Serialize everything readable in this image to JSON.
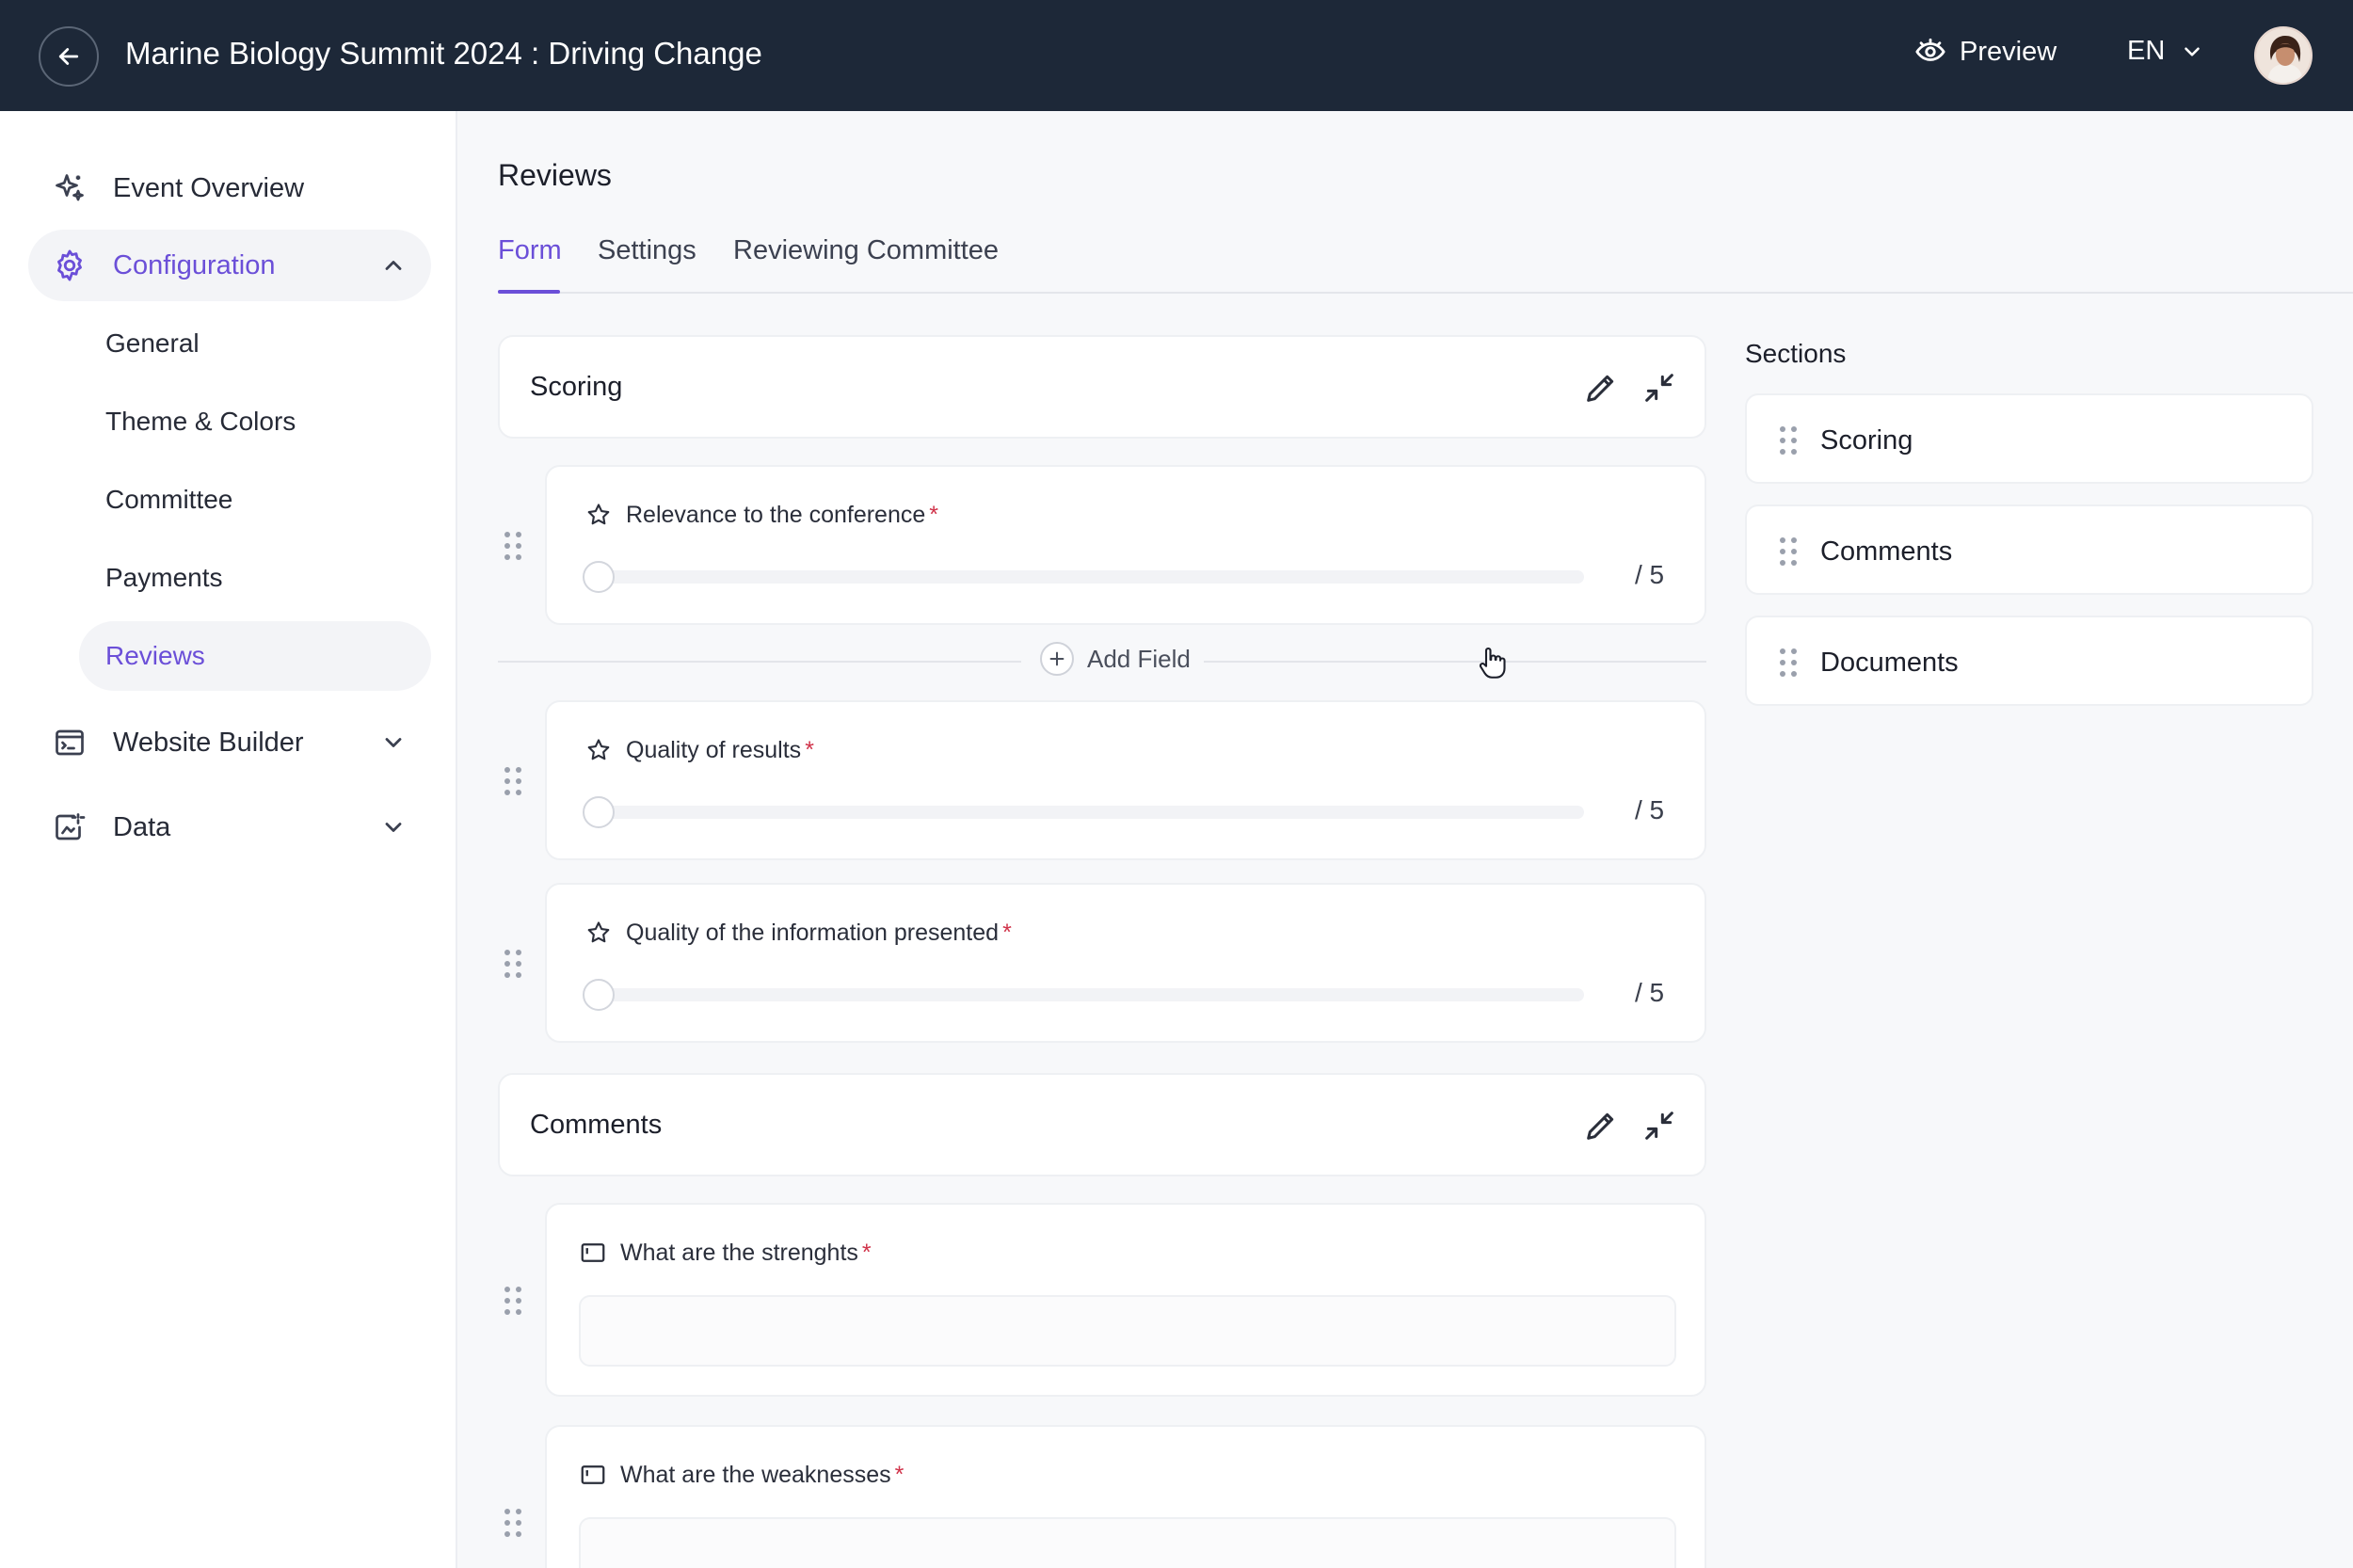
{
  "header": {
    "event_title": "Marine Biology Summit 2024 : Driving Change",
    "preview_label": "Preview",
    "language": "EN"
  },
  "sidebar": {
    "items": [
      {
        "label": "Event Overview",
        "icon": "sparkle-icon"
      },
      {
        "label": "Configuration",
        "icon": "gear-icon",
        "expanded": true,
        "active": true
      },
      {
        "label": "Website Builder",
        "icon": "website-icon"
      },
      {
        "label": "Data",
        "icon": "data-icon"
      }
    ],
    "config_sub": [
      "General",
      "Theme & Colors",
      "Committee",
      "Payments",
      "Reviews"
    ],
    "active_sub": "Reviews"
  },
  "page": {
    "title": "Reviews",
    "tabs": [
      "Form",
      "Settings",
      "Reviewing Committee"
    ],
    "active_tab": "Form"
  },
  "form": {
    "scoring_title": "Scoring",
    "scoring_fields": [
      {
        "label": "Relevance to the conference",
        "required": "*",
        "max": "/ 5",
        "value": 0
      },
      {
        "label": "Quality of results",
        "required": "*",
        "max": "/ 5",
        "value": 0
      },
      {
        "label": "Quality of the information presented",
        "required": "*",
        "max": "/ 5",
        "value": 0
      }
    ],
    "add_field_label": "Add Field",
    "comments_title": "Comments",
    "comment_fields": [
      {
        "label": "What are the strenghts",
        "required": "*"
      },
      {
        "label": "What are the weaknesses",
        "required": "*"
      }
    ]
  },
  "sections_panel": {
    "title": "Sections",
    "items": [
      "Scoring",
      "Comments",
      "Documents"
    ]
  },
  "colors": {
    "topbar": "#1d2838",
    "accent": "#6b4fd8",
    "required": "#d0334a"
  }
}
